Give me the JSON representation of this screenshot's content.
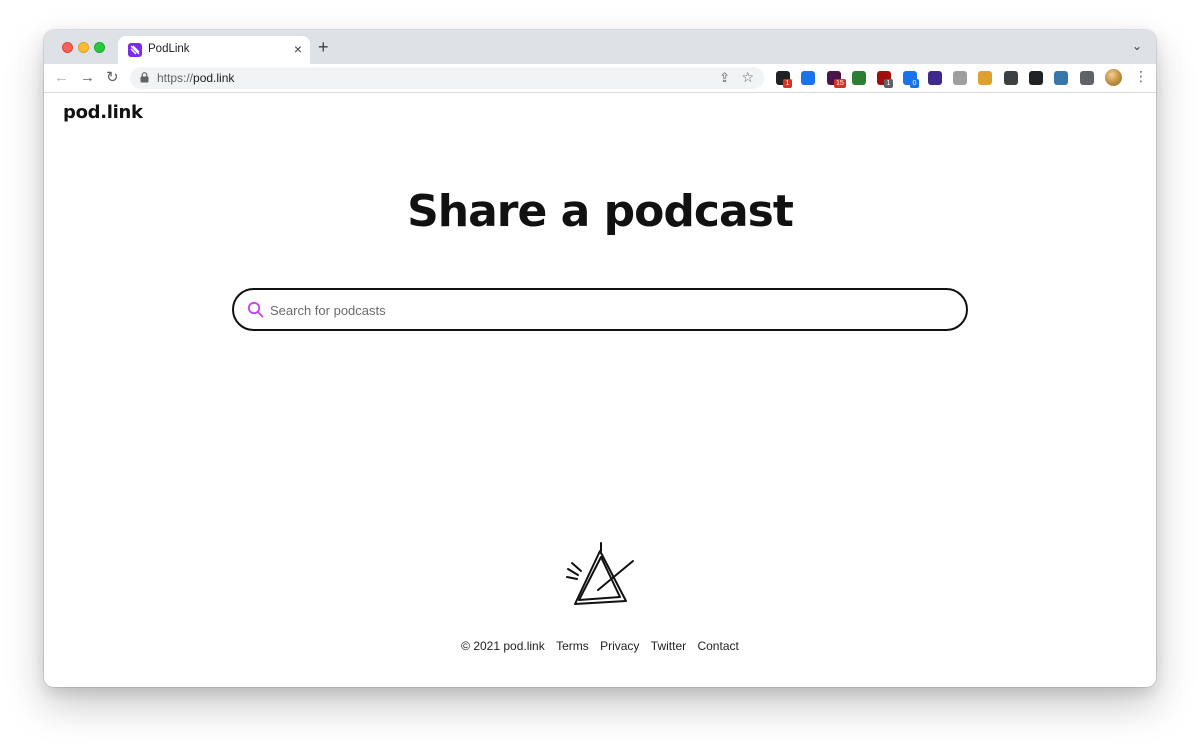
{
  "browser": {
    "tab": {
      "title": "PodLink",
      "close": "×"
    },
    "new_tab": "+",
    "tab_menu": "⌄",
    "nav": {
      "back": "←",
      "forward": "→",
      "reload": "↻"
    },
    "url": {
      "scheme": "https://",
      "host": "pod.link"
    },
    "extensions": [
      {
        "icon": "ext-dark-icon",
        "color": "#202124",
        "badge": "1",
        "badge_color": "#d93025"
      },
      {
        "icon": "ext-blue-circle-icon",
        "color": "#1a73e8",
        "badge": null
      },
      {
        "icon": "ext-slack-icon",
        "color": "#4a154b",
        "badge": "15",
        "badge_color": "#d93025"
      },
      {
        "icon": "ext-download-icon",
        "color": "#2e7d32",
        "badge": null
      },
      {
        "icon": "ext-shield-icon",
        "color": "#a50e0e",
        "badge": "1",
        "badge_color": "#5f6368"
      },
      {
        "icon": "ext-link-icon",
        "color": "#1a73e8",
        "badge": "0",
        "badge_color": "#1a73e8"
      },
      {
        "icon": "ext-ia-icon",
        "color": "#3f2a8c",
        "badge": null
      },
      {
        "icon": "ext-ghost-icon",
        "color": "#9e9e9e",
        "badge": null
      },
      {
        "icon": "ext-face-icon",
        "color": "#e0a030",
        "badge": null
      },
      {
        "icon": "ext-window-icon",
        "color": "#3c4043",
        "badge": null
      },
      {
        "icon": "ext-p-icon",
        "color": "#202124",
        "badge": null
      },
      {
        "icon": "ext-python-icon",
        "color": "#3776ab",
        "badge": null
      },
      {
        "icon": "puzzle-icon",
        "color": "#5f6368",
        "badge": null
      }
    ],
    "menu": "⋮"
  },
  "page": {
    "logo": "pod.link",
    "headline": "Share a podcast",
    "search": {
      "placeholder": "Search for podcasts",
      "value": ""
    },
    "footer": {
      "copyright": "© 2021 pod.link",
      "links": [
        "Terms",
        "Privacy",
        "Twitter",
        "Contact"
      ]
    }
  },
  "colors": {
    "accent": "#c742e8",
    "text": "#111111"
  }
}
